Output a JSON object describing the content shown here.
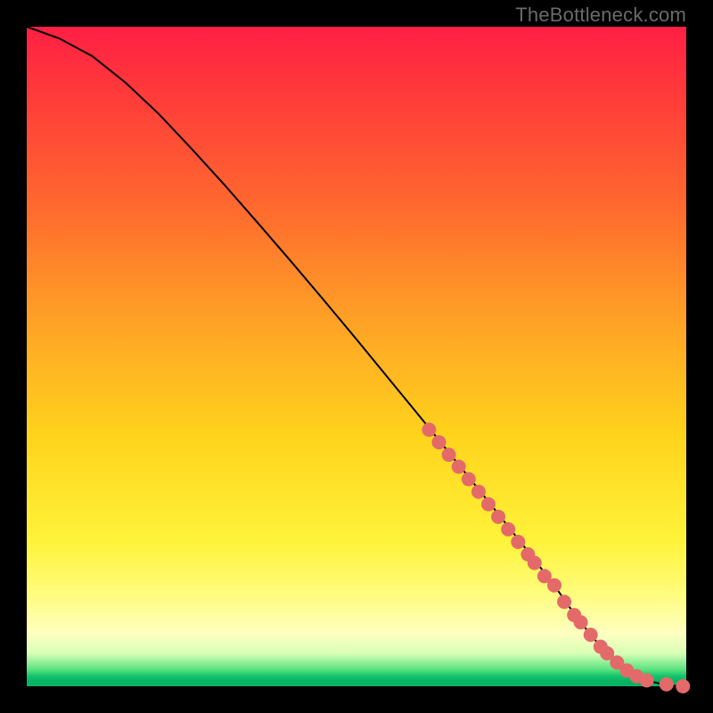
{
  "watermark": "TheBottleneck.com",
  "chart_data": {
    "type": "line",
    "title": "",
    "xlabel": "",
    "ylabel": "",
    "xlim": [
      0,
      100
    ],
    "ylim": [
      0,
      100
    ],
    "grid": false,
    "legend": false,
    "curve": {
      "name": "bottleneck-curve",
      "color": "#000000",
      "x": [
        0,
        5,
        10,
        15,
        20,
        25,
        30,
        35,
        40,
        45,
        50,
        55,
        60,
        65,
        70,
        75,
        80,
        82,
        84,
        86,
        88,
        90,
        92,
        94,
        96,
        98,
        100
      ],
      "y": [
        100,
        98.2,
        95.5,
        91.5,
        86.8,
        81.5,
        76.0,
        70.3,
        64.5,
        58.6,
        52.6,
        46.5,
        40.4,
        34.2,
        28.0,
        21.7,
        15.3,
        12.4,
        9.7,
        7.2,
        5.0,
        3.2,
        1.8,
        0.9,
        0.4,
        0.1,
        0.0
      ]
    },
    "highlight_points": {
      "name": "highlighted-range",
      "color": "#e46a6a",
      "x": [
        61.0,
        62.5,
        64.0,
        65.5,
        67.0,
        68.5,
        70.0,
        71.5,
        73.0,
        74.5,
        76.0,
        77.0,
        78.5,
        80.0,
        81.5,
        83.0,
        84.0,
        85.5,
        87.0,
        88.0,
        89.5,
        91.0,
        92.5,
        94.0,
        97.0,
        99.5
      ],
      "y": [
        38.9,
        37.0,
        35.1,
        33.3,
        31.4,
        29.5,
        27.6,
        25.7,
        23.8,
        21.9,
        20.0,
        18.7,
        16.7,
        15.3,
        12.8,
        10.8,
        9.7,
        7.8,
        6.0,
        5.0,
        3.6,
        2.4,
        1.5,
        0.9,
        0.3,
        0.0
      ]
    }
  }
}
